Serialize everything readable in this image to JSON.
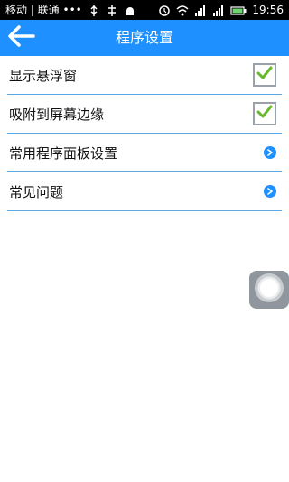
{
  "statusbar": {
    "carrier_text": "移动 | 联通 •••",
    "time": "19:56",
    "icons": [
      "usb-icon",
      "usb-debug-icon",
      "android-icon",
      "alarm-icon",
      "wifi-icon",
      "signal-icon",
      "signal-icon",
      "battery-icon"
    ]
  },
  "appbar": {
    "title": "程序设置",
    "back_icon": "back-arrow-icon",
    "color": "#1e90ff"
  },
  "settings": {
    "items": [
      {
        "label": "显示悬浮窗",
        "control": "checkbox",
        "checked": true
      },
      {
        "label": "吸附到屏幕边缘",
        "control": "checkbox",
        "checked": true
      },
      {
        "label": "常用程序面板设置",
        "control": "chevron"
      },
      {
        "label": "常见问题",
        "control": "chevron"
      }
    ]
  },
  "floating_button": {
    "icon": "assistive-touch-icon"
  },
  "colors": {
    "accent": "#1e90ff",
    "divider": "#5aa9e6",
    "check": "#67b82e"
  }
}
